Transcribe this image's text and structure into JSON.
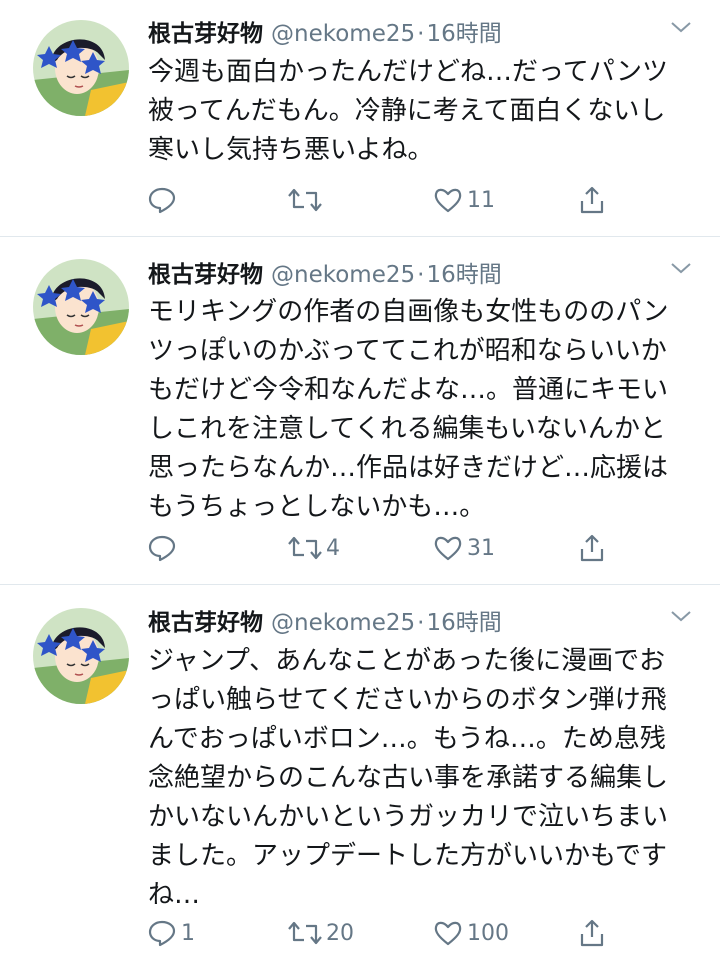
{
  "colors": {
    "text": "#14171a",
    "muted": "#657786",
    "divider": "#e1e8ed"
  },
  "tweets": [
    {
      "name": "根古芽好物",
      "handle": "@nekome25",
      "time": "16時間",
      "lines": [
        "今週も面白かったんだけどね…だってパンツ",
        "被ってんだもん。冷静に考えて面白くないし",
        "寒いし気持ち悪いよね。"
      ],
      "replies": "",
      "retweets": "",
      "likes": "11"
    },
    {
      "name": "根古芽好物",
      "handle": "@nekome25",
      "time": "16時間",
      "lines": [
        "モリキングの作者の自画像も女性もののパン",
        "ツっぽいのかぶっててこれが昭和ならいいか",
        "もだけど今令和なんだよな…。普通にキモい",
        "しこれを注意してくれる編集もいないんかと",
        "思ったらなんか…作品は好きだけど…応援は",
        "もうちょっとしないかも…。"
      ],
      "replies": "",
      "retweets": "4",
      "likes": "31"
    },
    {
      "name": "根古芽好物",
      "handle": "@nekome25",
      "time": "16時間",
      "lines": [
        "ジャンプ、あんなことがあった後に漫画でお",
        "っぱい触らせてくださいからのボタン弾け飛",
        "んでおっぱいボロン…。もうね…。ため息残",
        "念絶望からのこんな古い事を承諾する編集し",
        "かいないんかいというガッカリで泣いちまい",
        "ました。アップデートした方がいいかもです",
        "ね…"
      ],
      "replies": "1",
      "retweets": "20",
      "likes": "100"
    }
  ]
}
